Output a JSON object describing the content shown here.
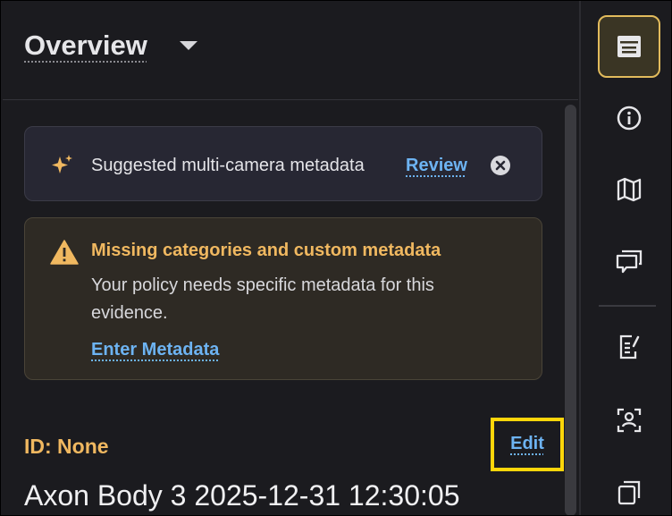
{
  "header": {
    "title": "Overview"
  },
  "suggestion_banner": {
    "text": "Suggested multi-camera metadata",
    "review_label": "Review"
  },
  "warning": {
    "title": "Missing categories and custom metadata",
    "body": "Your policy needs specific metadata for this evidence.",
    "action_label": "Enter Metadata"
  },
  "details": {
    "id_label": "ID: None",
    "edit_label": "Edit",
    "evidence_title": "Axon Body 3 2025-12-31 12:30:05"
  },
  "rail": {
    "items": [
      {
        "icon": "details-panel-icon",
        "active": true
      },
      {
        "icon": "info-icon",
        "active": false
      },
      {
        "icon": "map-icon",
        "active": false
      },
      {
        "icon": "comments-icon",
        "active": false
      },
      {
        "icon": "document-edit-icon",
        "active": false
      },
      {
        "icon": "person-scan-icon",
        "active": false
      },
      {
        "icon": "copies-icon",
        "active": false
      }
    ]
  },
  "colors": {
    "background": "#1b1b1f",
    "accent_gold": "#e2bb5c",
    "link_blue": "#6db3f2",
    "warning_orange": "#f0b860",
    "highlight_yellow": "#ffd60a"
  }
}
